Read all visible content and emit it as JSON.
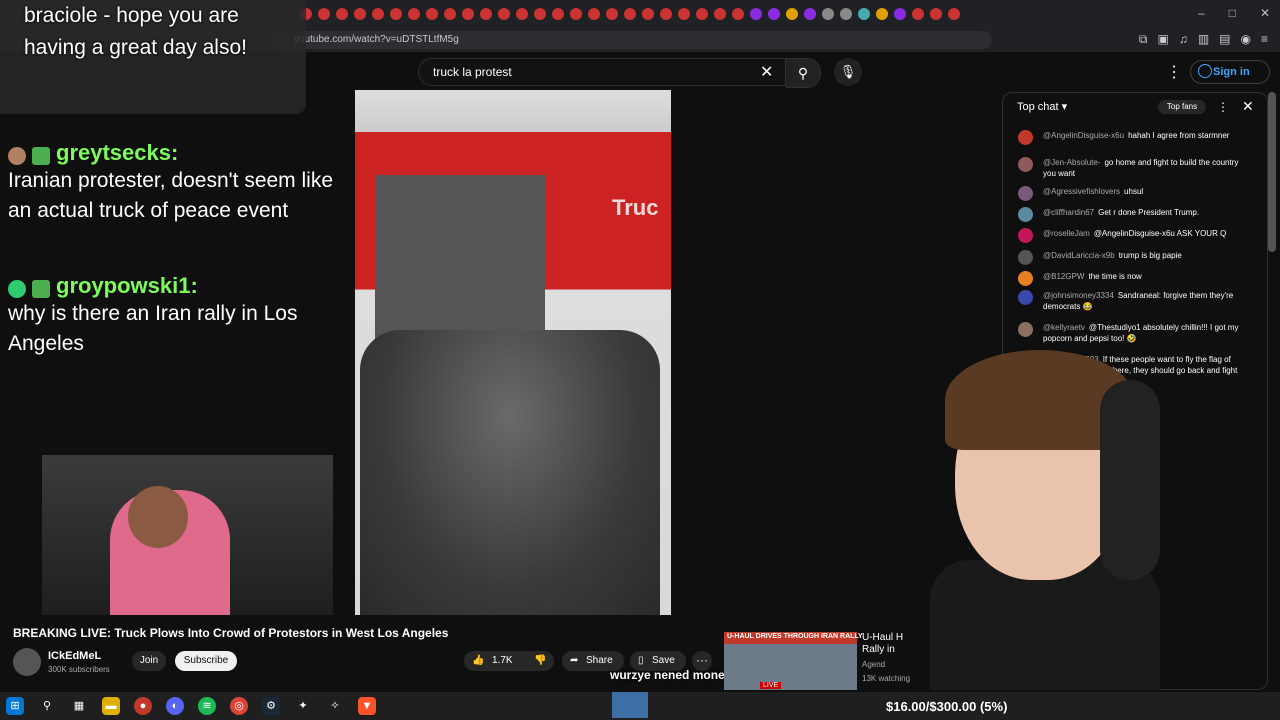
{
  "browser": {
    "url": "youtube.com/watch?v=uDTSTLtfM5g",
    "window_controls": [
      "–",
      "□",
      "✕"
    ]
  },
  "youtube": {
    "search_value": "truck la protest",
    "sign_in": "Sign in"
  },
  "overlay": {
    "top_message": "braciole - hope you are having a great day also!",
    "chat": [
      {
        "name": "greytsecks:",
        "text": "Iranian protester, doesn't seem like an actual truck of peace event"
      },
      {
        "name": "groypowski1:",
        "text": "why is there an Iran rally in Los Angeles"
      }
    ],
    "bottom_caption": "wurzye nened money"
  },
  "video": {
    "truck_text": "Truc",
    "title": "BREAKING LIVE: Truck Plows Into Crowd of Protestors in West Los Angeles",
    "channel": "ICkEdMeL",
    "subscribers": "300K subscribers",
    "join": "Join",
    "subscribe": "Subscribe",
    "likes": "1.7K",
    "share": "Share",
    "save": "Save",
    "more": "···"
  },
  "suggested": {
    "thumb_label": "U-HAUL DRIVES THROUGH IRAN RALLY",
    "live_badge": "LIVE",
    "title": "U-Haul H Rally in",
    "meta1": "Agend",
    "meta2": "13K watching"
  },
  "chat": {
    "header": "Top chat",
    "top_fans": "Top fans",
    "messages": [
      {
        "author": "@AngelinDisguise-x6u",
        "text": "hahah I agree from starmner",
        "color": "#c0392b"
      },
      {
        "author": "@Jen-Absolute-",
        "text": "go home and fight to build the country you want",
        "color": "#8e5a5a"
      },
      {
        "author": "@Agressivefishlovers",
        "text": "uhsul",
        "color": "#7a5a7a"
      },
      {
        "author": "@cliffhardin67",
        "text": "Get r done President Trump.",
        "color": "#5a8aa0"
      },
      {
        "author": "@roselleJam",
        "text": "@AngelinDisguise-x6u ASK YOUR Q",
        "color": "#c2185b"
      },
      {
        "author": "@DavidLariccia-x9b",
        "text": "trump is big papie",
        "color": "#555555"
      },
      {
        "author": "@B12GPW",
        "text": "the time is now",
        "color": "#e67e22"
      },
      {
        "author": "@johnsimoney3334",
        "text": "Sandraneal: forgive them they're democrats 😂",
        "color": "#3949ab"
      },
      {
        "author": "@kellyraetv",
        "text": "@Thestudiyo1 absolutely chillin!!! I got my popcorn and pepsi too! 🤣",
        "color": "#8d6e63"
      },
      {
        "author": "@captainz2593",
        "text": "If these people want to fly the flag of their native country here, they should go back and fight there.",
        "color": "#8e24aa"
      }
    ]
  },
  "taskbar": {
    "donation_goal": "$16.00/$300.00 (5%)"
  }
}
